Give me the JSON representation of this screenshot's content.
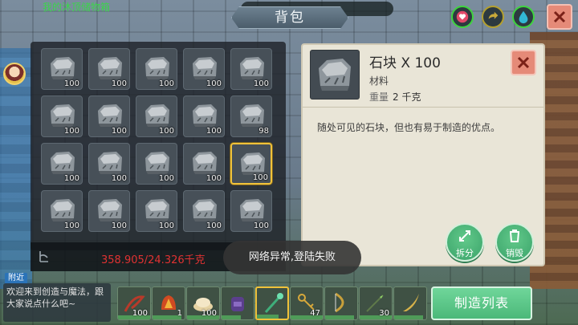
{
  "header": {
    "banner_text": "我的沐顶储物箱",
    "title": "背包"
  },
  "status_buttons": [
    "heart-icon",
    "refresh-arrow-icon",
    "water-drop-icon"
  ],
  "inventory": {
    "slots": [
      {
        "item": "stone",
        "qty": "100"
      },
      {
        "item": "stone",
        "qty": "100"
      },
      {
        "item": "stone",
        "qty": "100"
      },
      {
        "item": "stone",
        "qty": "100"
      },
      {
        "item": "stone",
        "qty": "100"
      },
      {
        "item": "stone",
        "qty": "100"
      },
      {
        "item": "stone",
        "qty": "100"
      },
      {
        "item": "stone",
        "qty": "100"
      },
      {
        "item": "stone",
        "qty": "100"
      },
      {
        "item": "stone",
        "qty": "98"
      },
      {
        "item": "stone",
        "qty": "100"
      },
      {
        "item": "stone",
        "qty": "100"
      },
      {
        "item": "stone",
        "qty": "100"
      },
      {
        "item": "stone",
        "qty": "100"
      },
      {
        "item": "stone",
        "qty": "100",
        "selected": true
      },
      {
        "item": "stone",
        "qty": "100"
      },
      {
        "item": "stone",
        "qty": "100"
      },
      {
        "item": "stone",
        "qty": "100"
      },
      {
        "item": "stone",
        "qty": "100"
      },
      {
        "item": "stone",
        "qty": "100"
      }
    ],
    "weight_text": "358.905/24.326千克"
  },
  "detail": {
    "name": "石块 X 100",
    "type": "材料",
    "weight_label": "重量",
    "weight_value": "2 千克",
    "description": "随处可见的石块，但也有易于制造的优点。",
    "split_label": "拆分",
    "destroy_label": "销毁"
  },
  "toast": "网络异常,登陆失败",
  "chat": {
    "tab": "附近",
    "message": "欢迎来到创造与魔法，跟大家说点什么吧~"
  },
  "hotbar": [
    {
      "item": "red-whip",
      "qty": "100",
      "fill": 1.0
    },
    {
      "item": "fire-helmet",
      "qty": "1",
      "fill": 0.9
    },
    {
      "item": "dumpling-bowl",
      "qty": "100",
      "fill": 1.0
    },
    {
      "item": "purple-backpack",
      "qty": "",
      "fill": 0.6
    },
    {
      "item": "green-staff",
      "qty": "",
      "fill": 0.7,
      "selected": true
    },
    {
      "item": "keys",
      "qty": "47",
      "fill": 1.0
    },
    {
      "item": "golden-bow",
      "qty": "",
      "fill": 0.9
    },
    {
      "item": "green-spear",
      "qty": "30",
      "fill": 1.0
    },
    {
      "item": "golden-blade",
      "qty": "",
      "fill": 0.9
    }
  ],
  "craft_button": "制造列表",
  "colors": {
    "weight_warning": "#e03232",
    "accent_green": "#4bb879",
    "selected_gold": "#f0c23a",
    "close_red": "#e58a78"
  }
}
